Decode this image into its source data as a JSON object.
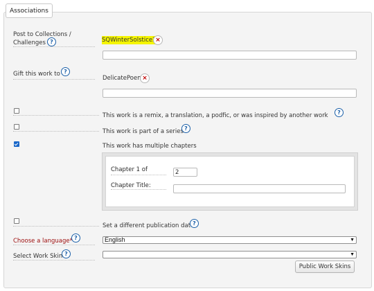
{
  "legend": "Associations",
  "collections": {
    "label_line1": "Post to Collections /",
    "label_line2": "Challenges",
    "tag": "SQWinterSolstice2",
    "remove_glyph": "×"
  },
  "gift": {
    "label": "Gift this work to",
    "tag": "DelicatePoem",
    "remove_glyph": "×"
  },
  "help_glyph": "?",
  "options": {
    "remix": {
      "text": "This work is a remix, a translation, a podfic, or was inspired by another work",
      "checked": false
    },
    "series": {
      "text": "This work is part of a series",
      "checked": false
    },
    "chapters": {
      "text": "This work has multiple chapters",
      "checked": true
    },
    "pubdate": {
      "text": "Set a different publication date",
      "checked": false
    }
  },
  "chapter": {
    "of_label": "Chapter 1 of",
    "of_value": "2",
    "title_label": "Chapter Title:",
    "title_value": ""
  },
  "language": {
    "label": "Choose a language*",
    "selected": "English"
  },
  "skin": {
    "label": "Select Work Skin",
    "selected": "",
    "button": "Public Work Skins"
  },
  "colors": {
    "required": "#9b0a0a",
    "highlight": "#f5f500",
    "help": "#1a5fa8",
    "remove": "#c00000",
    "checkbox_on": "#1a67c8"
  }
}
